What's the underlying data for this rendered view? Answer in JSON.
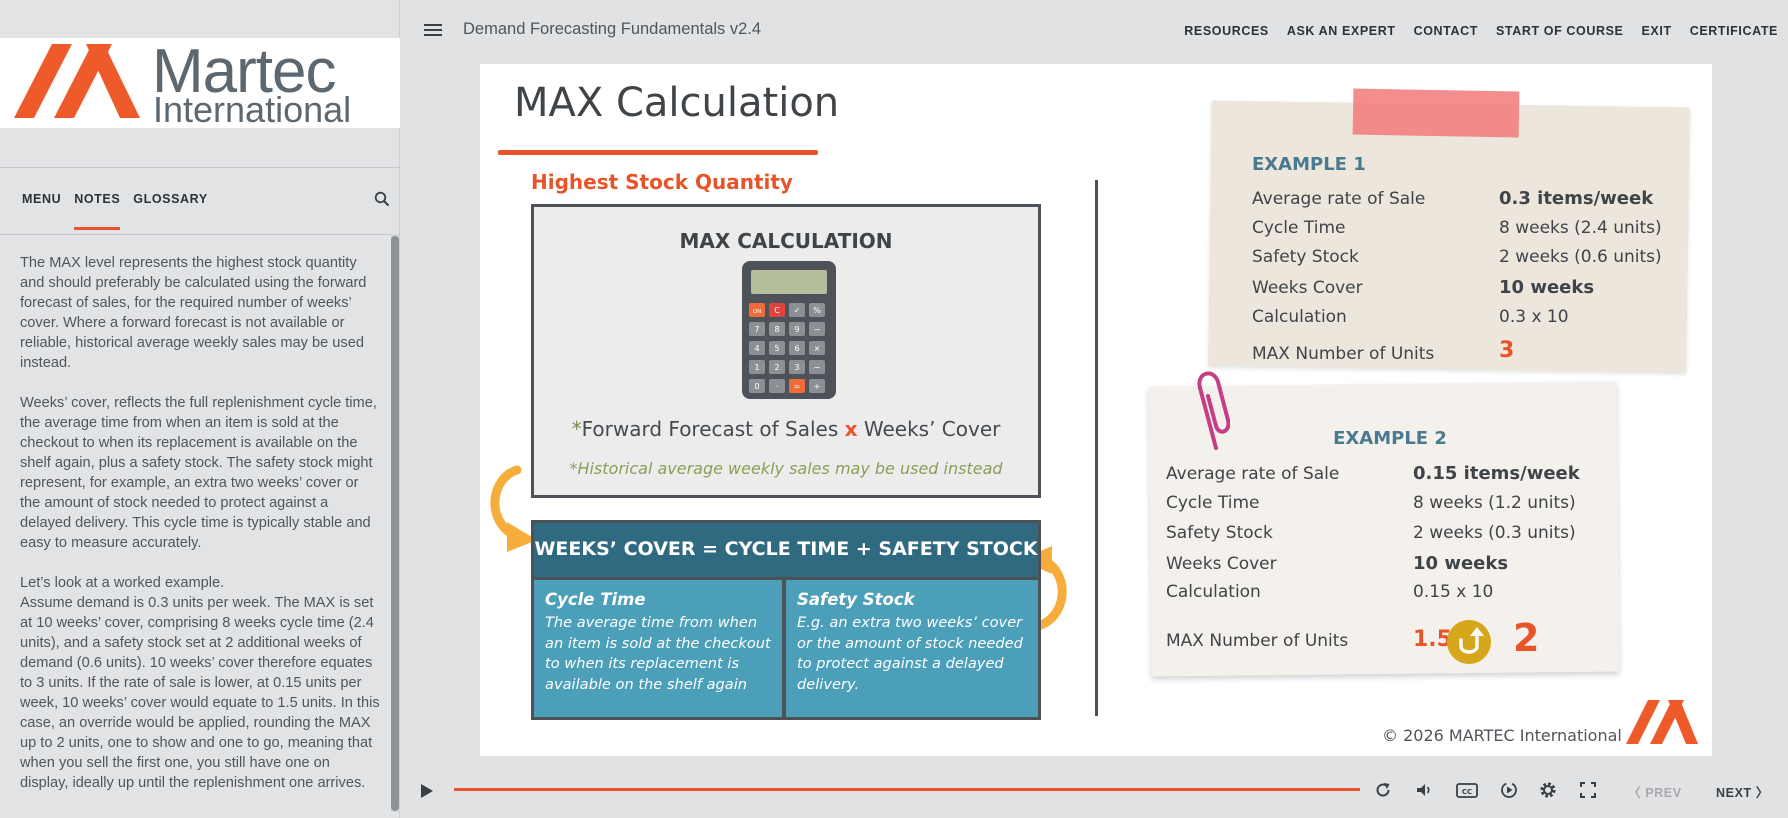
{
  "sidebar": {
    "logo": {
      "word1": "Martec",
      "word2": "International"
    },
    "tabs": [
      {
        "label": "MENU"
      },
      {
        "label": "NOTES"
      },
      {
        "label": "GLOSSARY"
      }
    ],
    "active_tab": "NOTES",
    "notes": [
      "The MAX level represents the highest stock quantity and should preferably be calculated using the forward forecast of sales, for the required number of weeks’ cover. Where a forward forecast is not available or reliable, historical average weekly sales may be used instead.",
      "Weeks’ cover, reflects the full replenishment cycle time, the average time from when an item is sold at the checkout to when its replacement is available on the shelf again, plus a safety stock. The safety stock might represent, for example, an extra two weeks’ cover or the amount of stock needed to protect against a delayed delivery. This cycle time is typically stable and easy to measure accurately.",
      "Let’s look at a worked example.",
      "Assume demand is 0.3 units per week. The MAX is set at 10 weeks’ cover, comprising 8 weeks cycle time (2.4 units), and a safety stock set at 2 additional weeks of demand (0.6 units). 10 weeks’ cover therefore equates to 3 units. If the rate of sale is lower, at 0.15 units per week, 10 weeks’ cover would equate to 1.5 units. In this case, an override would be applied, rounding the MAX up to 2 units, one to show and one to go, meaning that when you sell the first one, you still have one on display, ideally up until the replenishment one arrives."
    ]
  },
  "header": {
    "course_title": "Demand Forecasting Fundamentals v2.4",
    "nav": [
      "RESOURCES",
      "ASK AN EXPERT",
      "CONTACT",
      "START OF COURSE",
      "EXIT",
      "CERTIFICATE"
    ]
  },
  "slide": {
    "title": "MAX Calculation",
    "subheading": "Highest Stock Quantity",
    "calc_box": {
      "title": "MAX CALCULATION",
      "formula_asterisk": "*",
      "formula_part1": "Forward Forecast of Sales ",
      "formula_times": "x",
      "formula_part2": " Weeks’ Cover",
      "note": "*Historical average weekly sales may be used instead",
      "calculator_keys": [
        "ON",
        "C",
        "✓",
        "%",
        "7",
        "8",
        "9",
        "−",
        "4",
        "5",
        "6",
        "×",
        "1",
        "2",
        "3",
        "−",
        "0",
        "·",
        "=",
        "+"
      ]
    },
    "weeks_box": {
      "header": "WEEKS’ COVER  = CYCLE TIME + SAFETY STOCK",
      "cycle_title": "Cycle Time",
      "cycle_text": "The average time from when an item is sold at the checkout to when its replacement is available on the shelf again",
      "safety_title": "Safety Stock",
      "safety_text": "E.g. an extra two weeks’ cover or the amount of stock needed to protect against a delayed delivery."
    },
    "example1": {
      "title": "EXAMPLE 1",
      "rows": [
        {
          "label": "Average rate of Sale",
          "value": "0.3 items/week"
        },
        {
          "label": "Cycle Time",
          "value": "8 weeks (2.4 units)"
        },
        {
          "label": "Safety Stock",
          "value": "2 weeks (0.6 units)"
        },
        {
          "label": "Weeks Cover",
          "value": "10 weeks"
        },
        {
          "label": "Calculation",
          "value": "0.3 x 10"
        },
        {
          "label": "MAX Number of Units",
          "value": "3"
        }
      ]
    },
    "example2": {
      "title": "EXAMPLE 2",
      "rows": [
        {
          "label": "Average rate of Sale",
          "value": "0.15 items/week"
        },
        {
          "label": "Cycle Time",
          "value": "8 weeks (1.2 units)"
        },
        {
          "label": "Safety Stock",
          "value": "2 weeks (0.3 units)"
        },
        {
          "label": "Weeks Cover",
          "value": "10 weeks"
        },
        {
          "label": "Calculation",
          "value": "0.15 x 10"
        },
        {
          "label": "MAX Number of Units",
          "value": "1.5",
          "rounded": "2"
        }
      ]
    },
    "copyright": "© 2026 MARTEC International"
  },
  "player": {
    "progress": 1.0,
    "prev_label": "PREV",
    "next_label": "NEXT",
    "icons": [
      "replay-icon",
      "volume-icon",
      "captions-icon",
      "playback-speed-icon",
      "settings-icon",
      "fullscreen-icon"
    ]
  },
  "colors": {
    "accent": "#e7542a",
    "teal_dark": "#2f6a80",
    "teal_light": "#4c9fb9",
    "example_title": "#4a7a90",
    "note_green": "#8a9f55",
    "gold": "#d6a71a"
  }
}
